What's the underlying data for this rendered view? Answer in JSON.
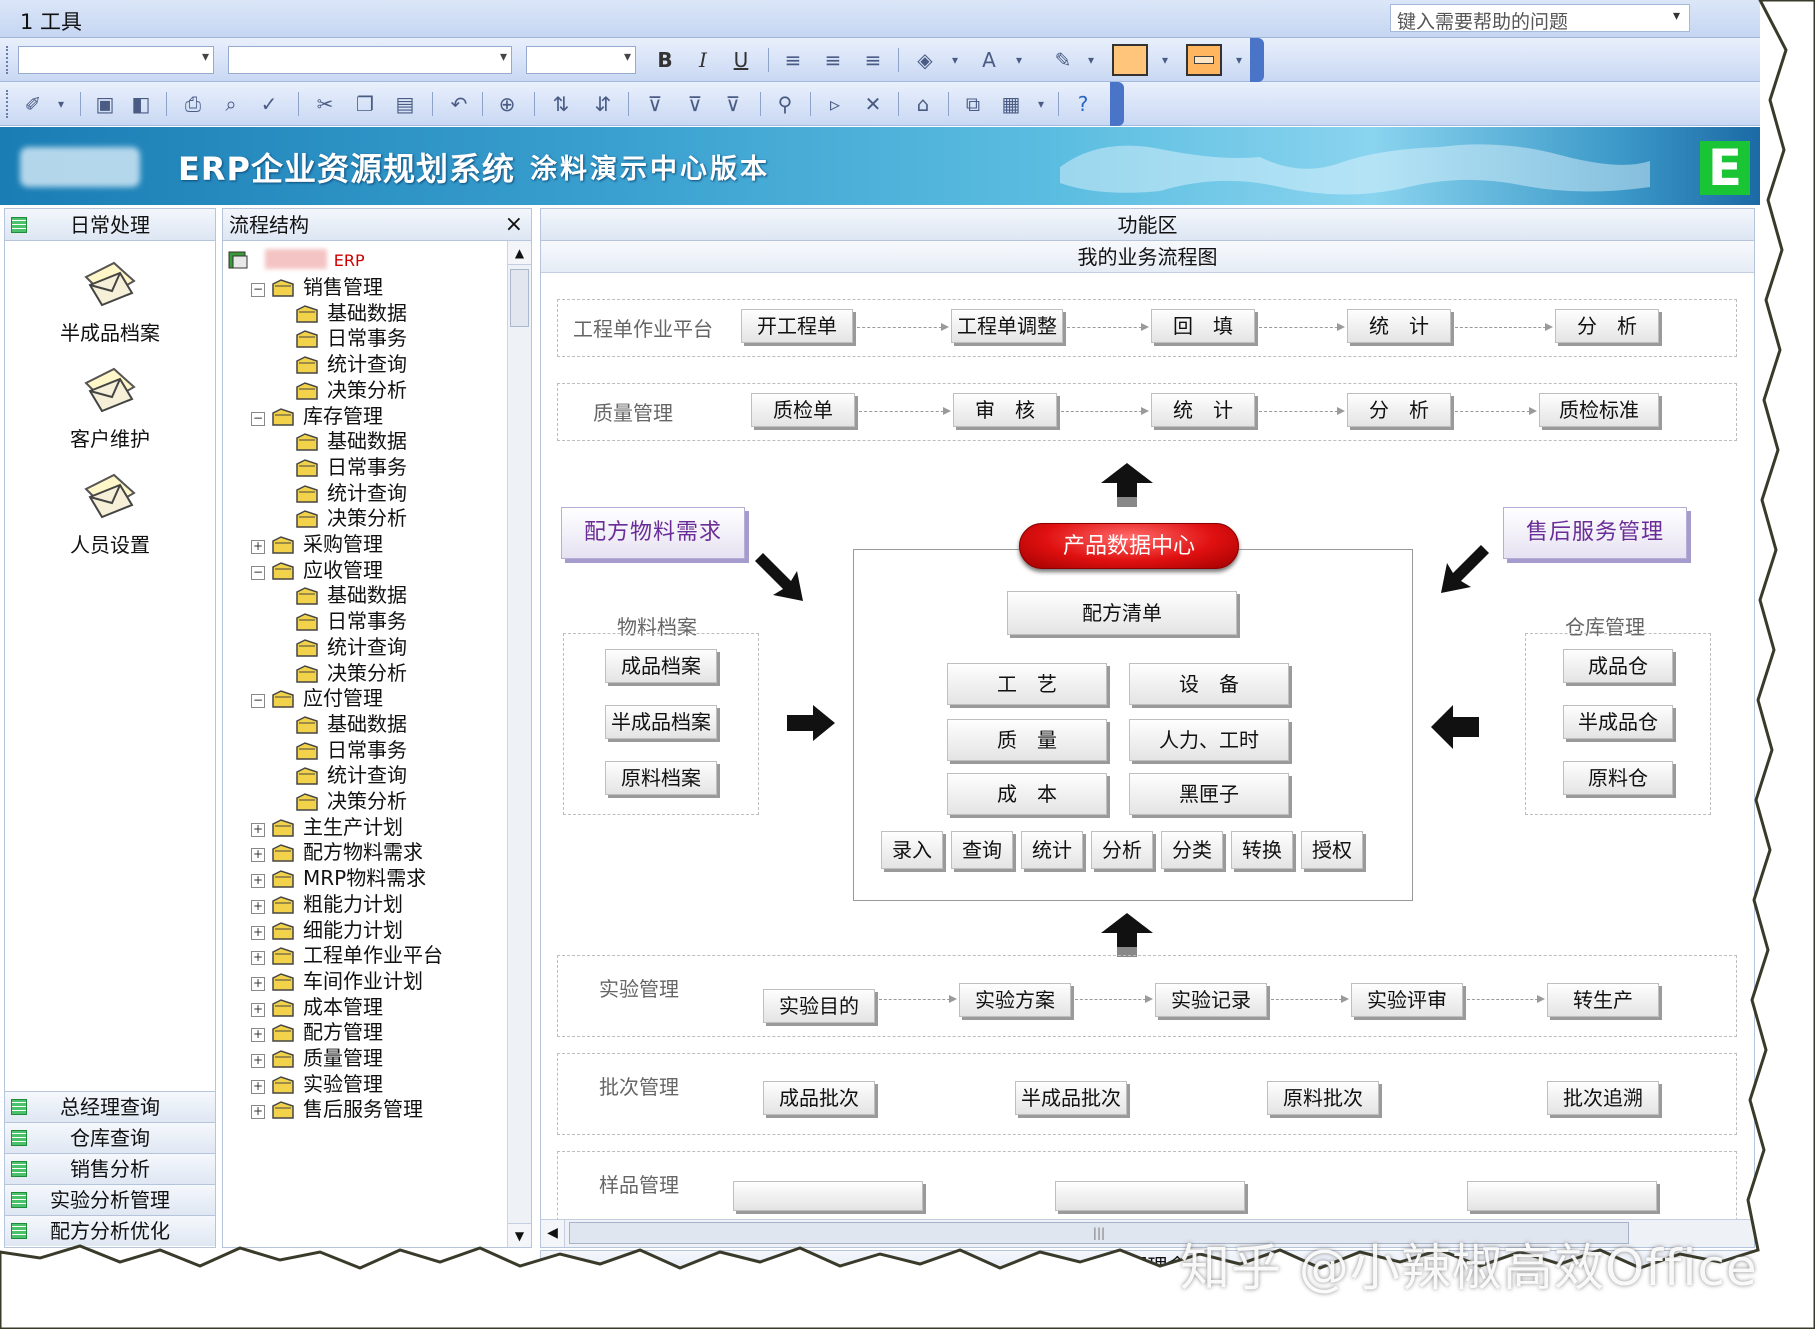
{
  "menu": {
    "label": "1 工具"
  },
  "help": {
    "placeholder": "键入需要帮助的问题"
  },
  "toolbar1": {
    "bold": "B",
    "italic": "I",
    "underline": "U",
    "font_color": "A"
  },
  "banner": {
    "title": "ERP企业资源规划系统",
    "subtitle": "涂料演示中心版本",
    "logo_letter": "E"
  },
  "left_panel": {
    "header": "日常处理",
    "items": [
      {
        "label": "半成品档案",
        "icon": "envelope-icon"
      },
      {
        "label": "客户维护",
        "icon": "envelope-icon"
      },
      {
        "label": "人员设置",
        "icon": "envelope-icon"
      }
    ],
    "bottom_tabs": [
      "总经理查询",
      "仓库查询",
      "销售分析",
      "实验分析管理",
      "配方分析优化"
    ]
  },
  "tree_panel": {
    "header": "流程结构",
    "close": "×",
    "root": "ERP",
    "rows": [
      {
        "label": "销售管理",
        "level": 1,
        "toggle": "−"
      },
      {
        "label": "基础数据",
        "level": 2
      },
      {
        "label": "日常事务",
        "level": 2
      },
      {
        "label": "统计查询",
        "level": 2
      },
      {
        "label": "决策分析",
        "level": 2
      },
      {
        "label": "库存管理",
        "level": 1,
        "toggle": "−"
      },
      {
        "label": "基础数据",
        "level": 2
      },
      {
        "label": "日常事务",
        "level": 2
      },
      {
        "label": "统计查询",
        "level": 2
      },
      {
        "label": "决策分析",
        "level": 2
      },
      {
        "label": "采购管理",
        "level": 1,
        "toggle": "+"
      },
      {
        "label": "应收管理",
        "level": 1,
        "toggle": "−"
      },
      {
        "label": "基础数据",
        "level": 2
      },
      {
        "label": "日常事务",
        "level": 2
      },
      {
        "label": "统计查询",
        "level": 2
      },
      {
        "label": "决策分析",
        "level": 2
      },
      {
        "label": "应付管理",
        "level": 1,
        "toggle": "−"
      },
      {
        "label": "基础数据",
        "level": 2
      },
      {
        "label": "日常事务",
        "level": 2
      },
      {
        "label": "统计查询",
        "level": 2
      },
      {
        "label": "决策分析",
        "level": 2
      },
      {
        "label": "主生产计划",
        "level": 1,
        "toggle": "+"
      },
      {
        "label": "配方物料需求",
        "level": 1,
        "toggle": "+"
      },
      {
        "label": "MRP物料需求",
        "level": 1,
        "toggle": "+"
      },
      {
        "label": "粗能力计划",
        "level": 1,
        "toggle": "+"
      },
      {
        "label": "细能力计划",
        "level": 1,
        "toggle": "+"
      },
      {
        "label": "工程单作业平台",
        "level": 1,
        "toggle": "+"
      },
      {
        "label": "车间作业计划",
        "level": 1,
        "toggle": "+"
      },
      {
        "label": "成本管理",
        "level": 1,
        "toggle": "+"
      },
      {
        "label": "配方管理",
        "level": 1,
        "toggle": "+"
      },
      {
        "label": "质量管理",
        "level": 1,
        "toggle": "+"
      },
      {
        "label": "实验管理",
        "level": 1,
        "toggle": "+"
      },
      {
        "label": "售后服务管理",
        "level": 1,
        "toggle": "+"
      }
    ]
  },
  "function_area": {
    "header": "功能区",
    "subheader": "我的业务流程图",
    "row_project": {
      "label": "工程单作业平台",
      "buttons": [
        "开工程单",
        "工程单调整",
        "回　填",
        "统　计",
        "分　析"
      ]
    },
    "row_quality": {
      "label": "质量管理",
      "buttons": [
        "质检单",
        "审　核",
        "统　计",
        "分　析",
        "质检标准"
      ]
    },
    "tag_left": "配方物料需求",
    "tag_right": "售后服务管理",
    "center": {
      "pill": "产品数据中心",
      "main": "配方清单",
      "grid": [
        "工　艺",
        "设　备",
        "质　量",
        "人力、工时",
        "成　本",
        "黑匣子"
      ],
      "actions": [
        "录入",
        "查询",
        "统计",
        "分析",
        "分类",
        "转换",
        "授权"
      ]
    },
    "group_material": {
      "label": "物料档案",
      "items": [
        "成品档案",
        "半成品档案",
        "原料档案"
      ]
    },
    "group_warehouse": {
      "label": "仓库管理",
      "items": [
        "成品仓",
        "半成品仓",
        "原料仓"
      ]
    },
    "row_experiment": {
      "label": "实验管理",
      "buttons": [
        "实验目的",
        "实验方案",
        "实验记录",
        "实验评审",
        "转生产"
      ]
    },
    "row_batch": {
      "label": "批次管理",
      "buttons": [
        "成品批次",
        "半成品批次",
        "原料批次",
        "批次追溯"
      ]
    },
    "row_sample": {
      "label": "样品管理"
    }
  },
  "status": {
    "label": "管理理念"
  },
  "watermark": "知乎 @小辣椒高效Office"
}
